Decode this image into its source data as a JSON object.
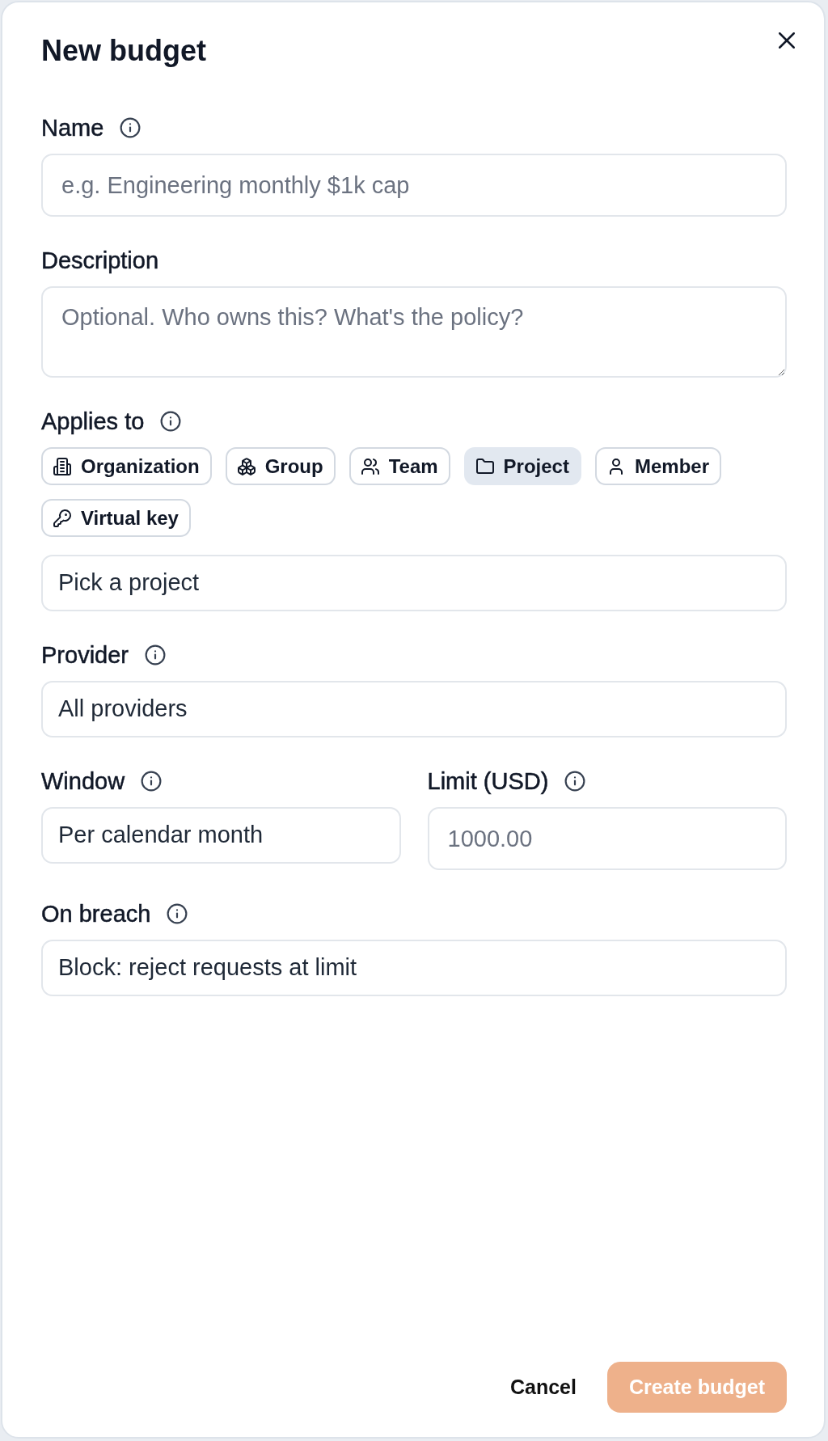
{
  "dialog": {
    "title": "New budget"
  },
  "fields": [
    {
      "kind": "text",
      "label": "Name",
      "info": true,
      "placeholder": "e.g. Engineering monthly $1k cap"
    },
    {
      "kind": "textarea",
      "label": "Description",
      "placeholder": "Optional. Who owns this? What's the policy?"
    },
    {
      "kind": "chips",
      "label": "Applies to",
      "info": true,
      "chips": [
        {
          "kind": "organization",
          "label": "Organization",
          "selected": false
        },
        {
          "kind": "group",
          "label": "Group",
          "selected": false
        },
        {
          "kind": "team",
          "label": "Team",
          "selected": false
        },
        {
          "kind": "project",
          "label": "Project",
          "selected": true
        },
        {
          "kind": "member",
          "label": "Member",
          "selected": false
        },
        {
          "kind": "key",
          "label": "Virtual key",
          "selected": false
        }
      ]
    },
    {
      "kind": "select",
      "value": "Pick a project"
    },
    {
      "kind": "select",
      "label": "Provider",
      "info": true,
      "value": "All providers"
    },
    {
      "kind": "pair",
      "items": [
        {
          "kind": "select",
          "label": "Window",
          "info": true,
          "value": "Per calendar month"
        },
        {
          "kind": "text",
          "label": "Limit (USD)",
          "info": true,
          "placeholder": "1000.00"
        }
      ]
    },
    {
      "kind": "select",
      "label": "On breach",
      "info": true,
      "value": "Block: reject requests at limit"
    }
  ],
  "footer": {
    "buttons": [
      {
        "kind": "secondary",
        "label": "Cancel",
        "disabled": false
      },
      {
        "kind": "primary",
        "label": "Create budget",
        "disabled": true
      }
    ]
  }
}
